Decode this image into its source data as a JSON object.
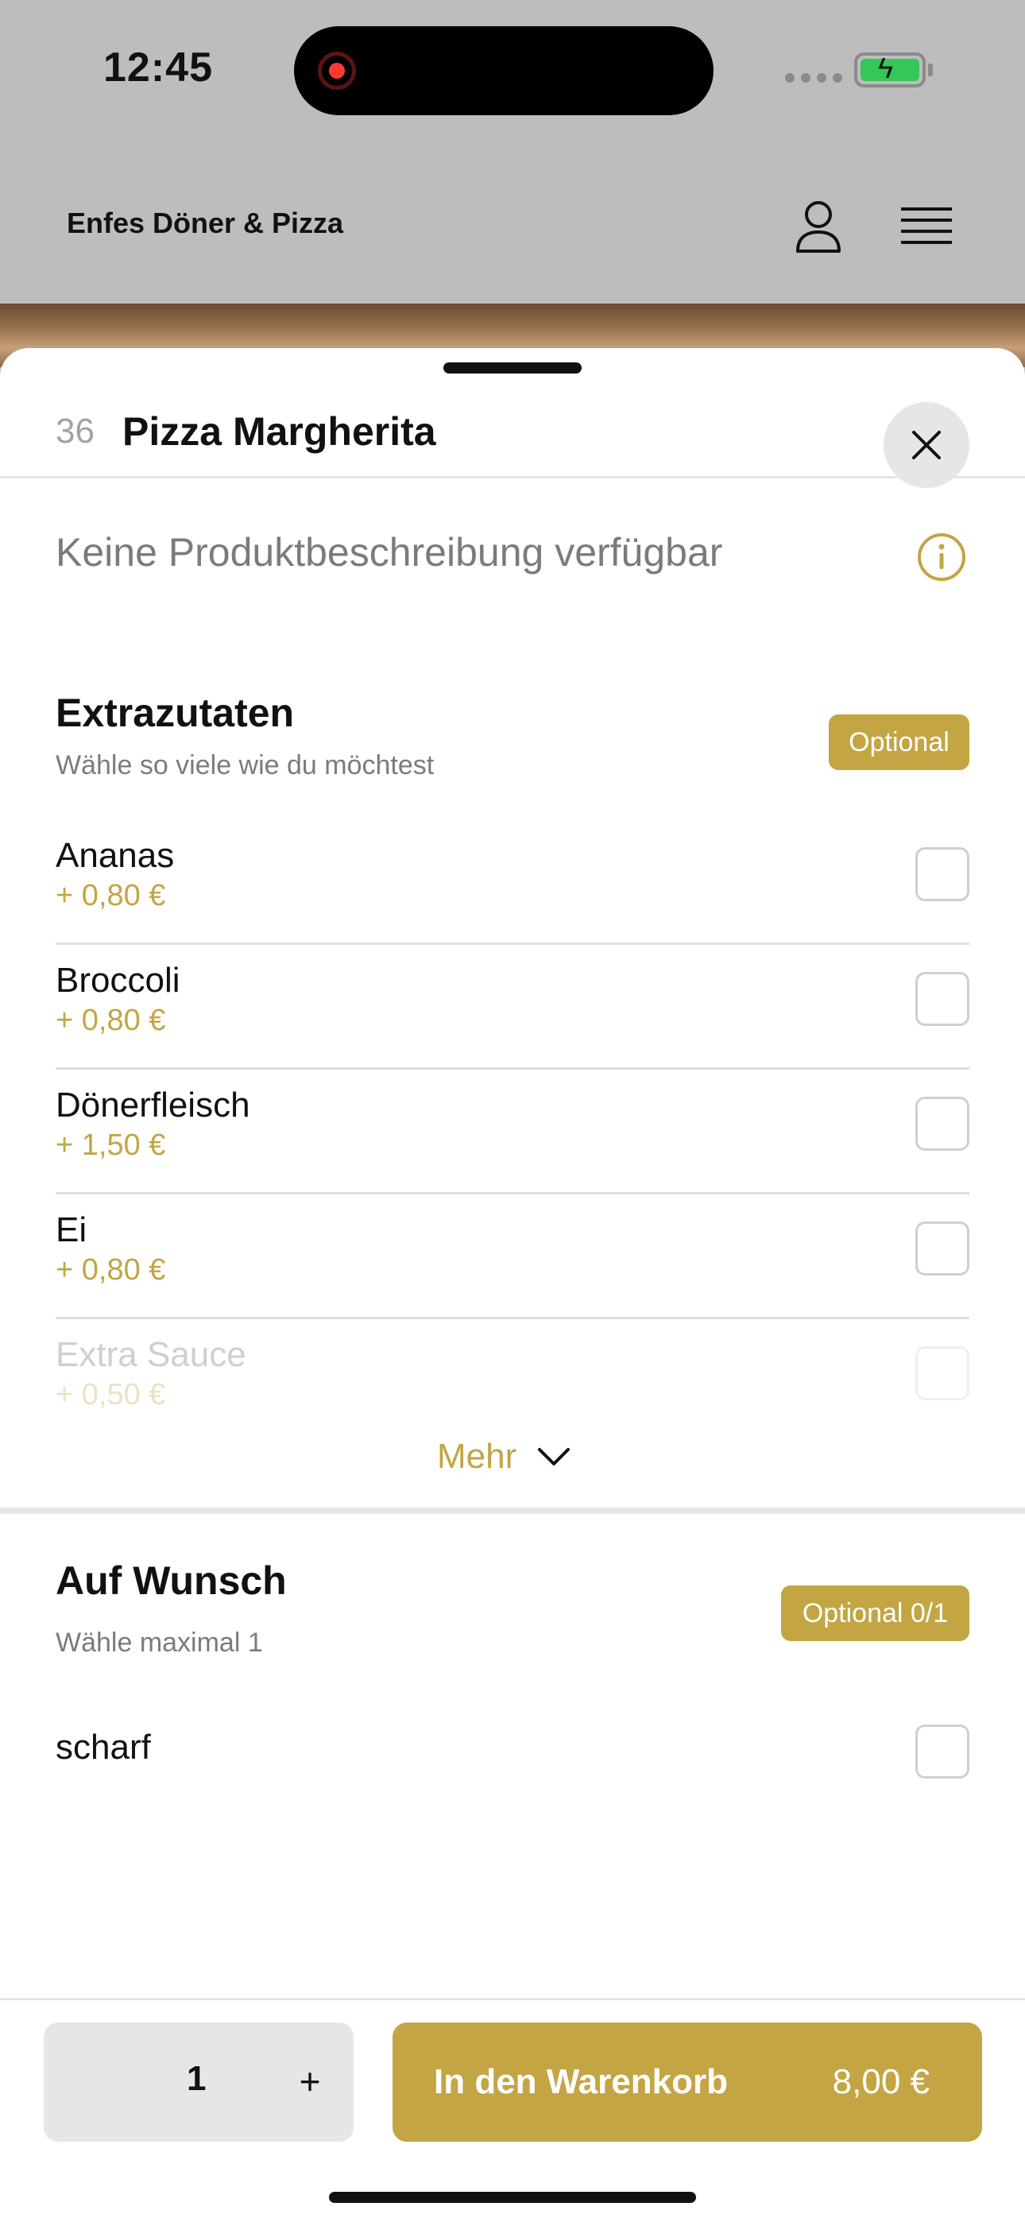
{
  "status_bar": {
    "time": "12:45"
  },
  "header": {
    "title": "Enfes Döner & Pizza"
  },
  "sheet": {
    "item_number": "36",
    "item_title": "Pizza Margherita",
    "description": "Keine Produktbeschreibung verfügbar"
  },
  "sections": [
    {
      "title": "Extrazutaten",
      "subtitle": "Wähle so viele wie du möchtest",
      "badge": "Optional",
      "options": [
        {
          "name": "Ananas",
          "price": "+ 0,80 €"
        },
        {
          "name": "Broccoli",
          "price": "+ 0,80 €"
        },
        {
          "name": "Dönerfleisch",
          "price": "+ 1,50 €"
        },
        {
          "name": "Ei",
          "price": "+ 0,80 €"
        },
        {
          "name": "Extra Sauce",
          "price": "+ 0,50 €"
        }
      ],
      "more_label": "Mehr"
    },
    {
      "title": "Auf Wunsch",
      "subtitle": "Wähle maximal 1",
      "badge": "Optional 0/1",
      "options": [
        {
          "name": "scharf"
        }
      ]
    }
  ],
  "footer": {
    "quantity": "1",
    "plus": "+",
    "cart_label": "In den Warenkorb",
    "cart_price": "8,00 €"
  },
  "colors": {
    "accent": "#c3a544",
    "background_overlay": "#bdbdbd",
    "muted_text": "#7b7b7b"
  },
  "icons": [
    "record-icon",
    "signal-icon",
    "battery-icon",
    "user-icon",
    "menu-icon",
    "close-icon",
    "info-icon",
    "chevron-down-icon"
  ]
}
